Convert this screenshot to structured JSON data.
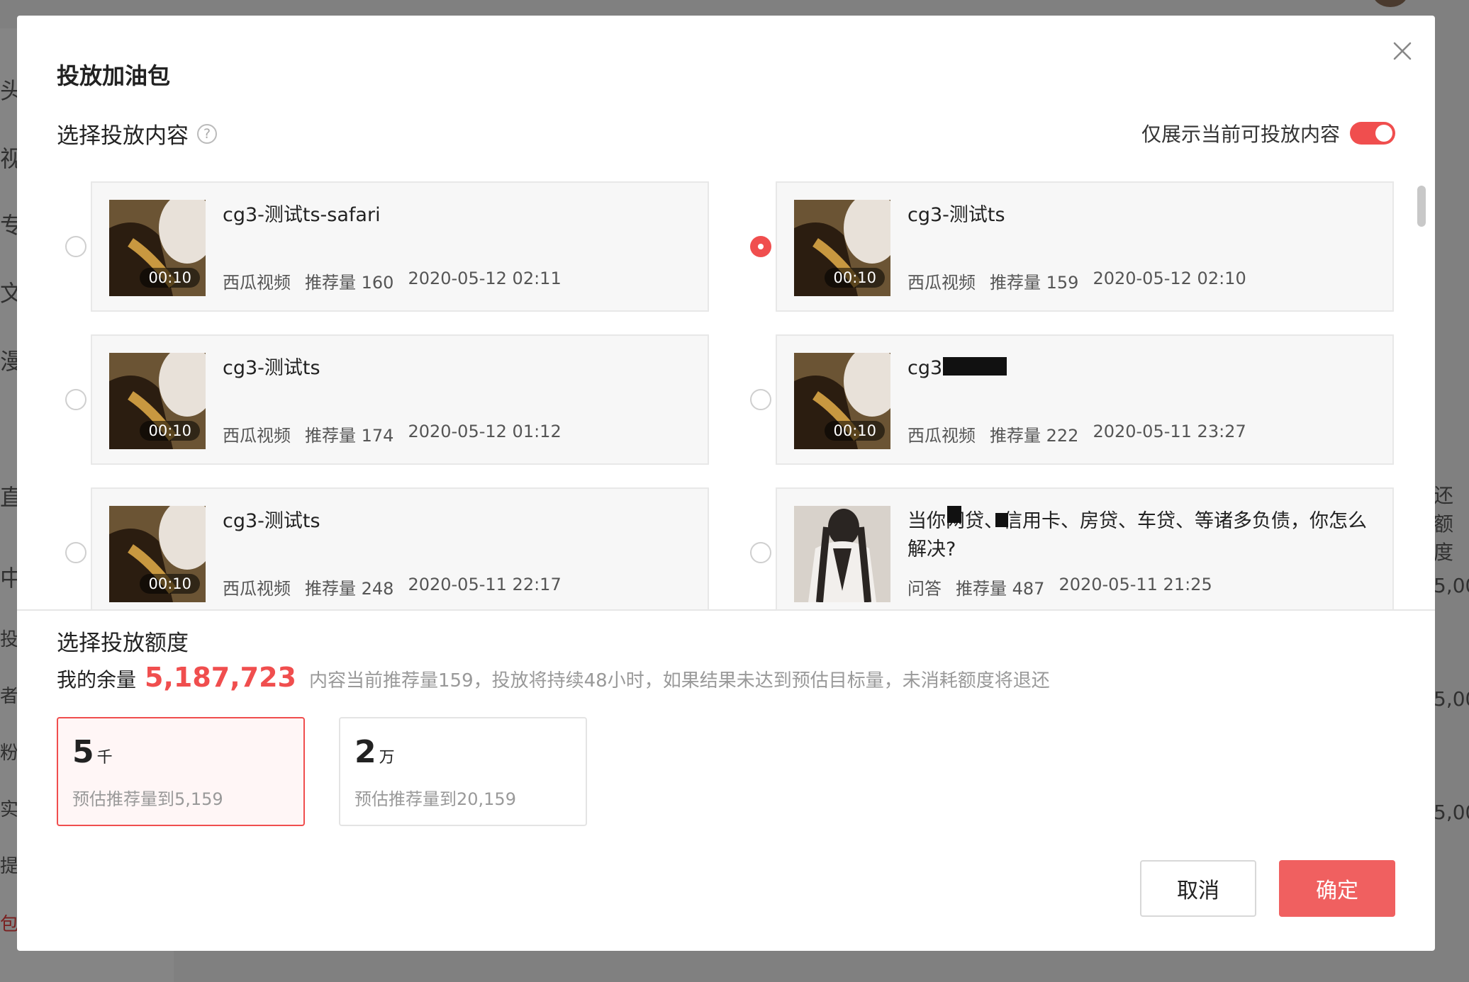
{
  "background": {
    "left_nav": [
      "头",
      "视",
      "专",
      "文",
      "漫",
      "直",
      "中",
      "投",
      "者",
      "粉",
      "实",
      "提",
      "包"
    ],
    "right_texts": [
      "还额度",
      "5,00",
      "5,00",
      "5,00"
    ]
  },
  "modal": {
    "title": "投放加油包",
    "close_icon": "close-icon",
    "content_section": {
      "title": "选择投放内容",
      "help_icon": "question-circle-icon",
      "toggle_label": "仅展示当前可投放内容",
      "toggle_on": true
    },
    "items": [
      {
        "title": "cg3-测试ts-safari",
        "duration": "00:10",
        "source": "西瓜视频",
        "recommend": "推荐量 160",
        "time": "2020-05-12 02:11",
        "selected": false
      },
      {
        "title": "cg3-测试ts",
        "duration": "00:10",
        "source": "西瓜视频",
        "recommend": "推荐量 159",
        "time": "2020-05-12 02:10",
        "selected": true
      },
      {
        "title": "cg3-测试ts",
        "duration": "00:10",
        "source": "西瓜视频",
        "recommend": "推荐量 174",
        "time": "2020-05-12 01:12",
        "selected": false
      },
      {
        "title": "cg3-测试ts",
        "duration": "00:10",
        "source": "西瓜视频",
        "recommend": "推荐量 222",
        "time": "2020-05-11 23:27",
        "selected": false
      },
      {
        "title": "cg3-测试ts",
        "duration": "00:10",
        "source": "西瓜视频",
        "recommend": "推荐量 248",
        "time": "2020-05-11 22:17",
        "selected": false
      },
      {
        "title": "当你网贷、信用卡、房贷、车贷、等诸多负债，你怎么解决?",
        "duration": "",
        "source": "问答",
        "recommend": "推荐量 487",
        "time": "2020-05-11 21:25",
        "selected": false
      }
    ],
    "amount_section": {
      "title": "选择投放额度",
      "balance_label": "我的余量",
      "balance_value": "5,187,723",
      "note": "内容当前推荐量159，投放将持续48小时，如果结果未达到预估目标量，未消耗额度将退还"
    },
    "options": [
      {
        "num": "5",
        "unit": "千",
        "desc": "预估推荐量到5,159",
        "selected": true
      },
      {
        "num": "2",
        "unit": "万",
        "desc": "预估推荐量到20,159",
        "selected": false
      }
    ],
    "cancel_label": "取消",
    "ok_label": "确定",
    "colors": {
      "accent": "#f04e4e",
      "ok_button": "#f06060"
    }
  }
}
